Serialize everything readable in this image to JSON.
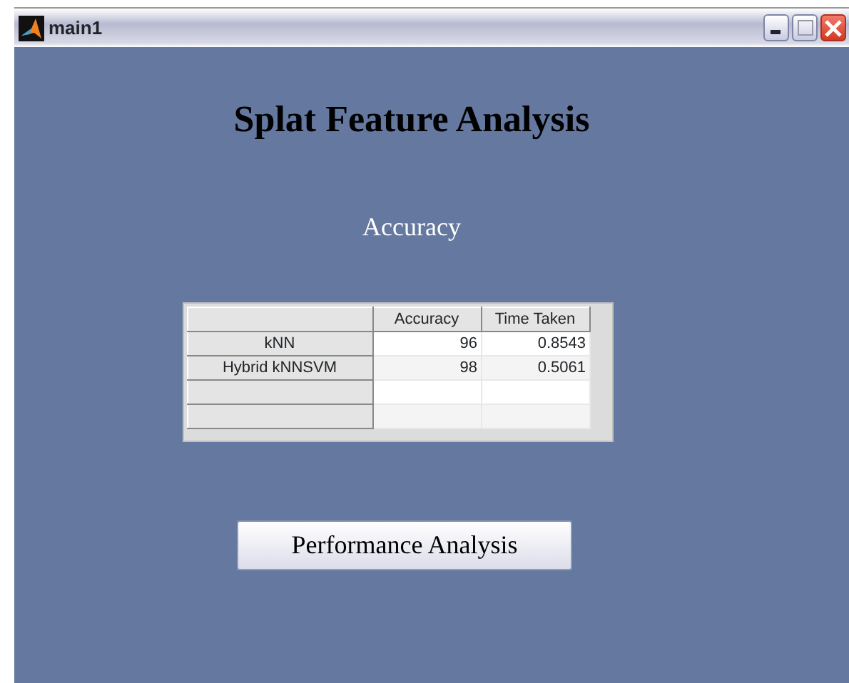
{
  "window": {
    "title": "main1"
  },
  "heading": "Splat Feature Analysis",
  "subheading": "Accuracy",
  "table": {
    "columns": [
      "Accuracy",
      "Time Taken"
    ],
    "rows": [
      {
        "label": "kNN",
        "cells": [
          "96",
          "0.8543"
        ]
      },
      {
        "label": "Hybrid kNNSVM",
        "cells": [
          "98",
          "0.5061"
        ]
      },
      {
        "label": "",
        "cells": [
          "",
          ""
        ]
      },
      {
        "label": "",
        "cells": [
          "",
          ""
        ]
      }
    ]
  },
  "button": "Performance Analysis"
}
